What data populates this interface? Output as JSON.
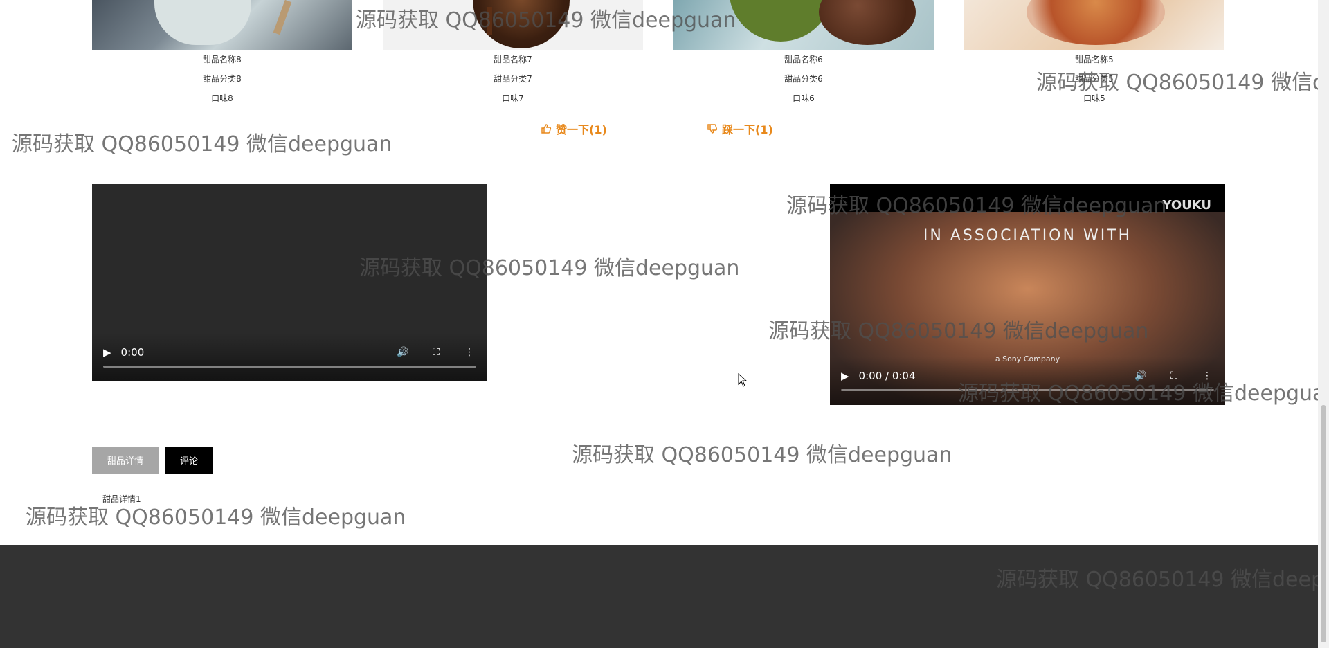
{
  "products": [
    {
      "name": "甜品名称8",
      "category": "甜品分类8",
      "flavor": "口味8"
    },
    {
      "name": "甜品名称7",
      "category": "甜品分类7",
      "flavor": "口味7"
    },
    {
      "name": "甜品名称6",
      "category": "甜品分类6",
      "flavor": "口味6"
    },
    {
      "name": "甜品名称5",
      "category": "甜品分类5",
      "flavor": "口味5"
    }
  ],
  "votes": {
    "like_label": "赞一下(1)",
    "dislike_label": "踩一下(1)"
  },
  "video_left": {
    "time": "0:00"
  },
  "video_right": {
    "time": "0:00 / 0:04",
    "brand": "YOUKU",
    "frame_caption": "IN ASSOCIATION WITH",
    "sub_caption": "a Sony Company"
  },
  "tabs": {
    "detail": "甜品详情",
    "comment": "评论"
  },
  "detail_text": "甜品详情1",
  "watermark": "源码获取 QQ86050149 微信deepguan",
  "colors": {
    "accent": "#e8891c",
    "footer": "#333333"
  }
}
